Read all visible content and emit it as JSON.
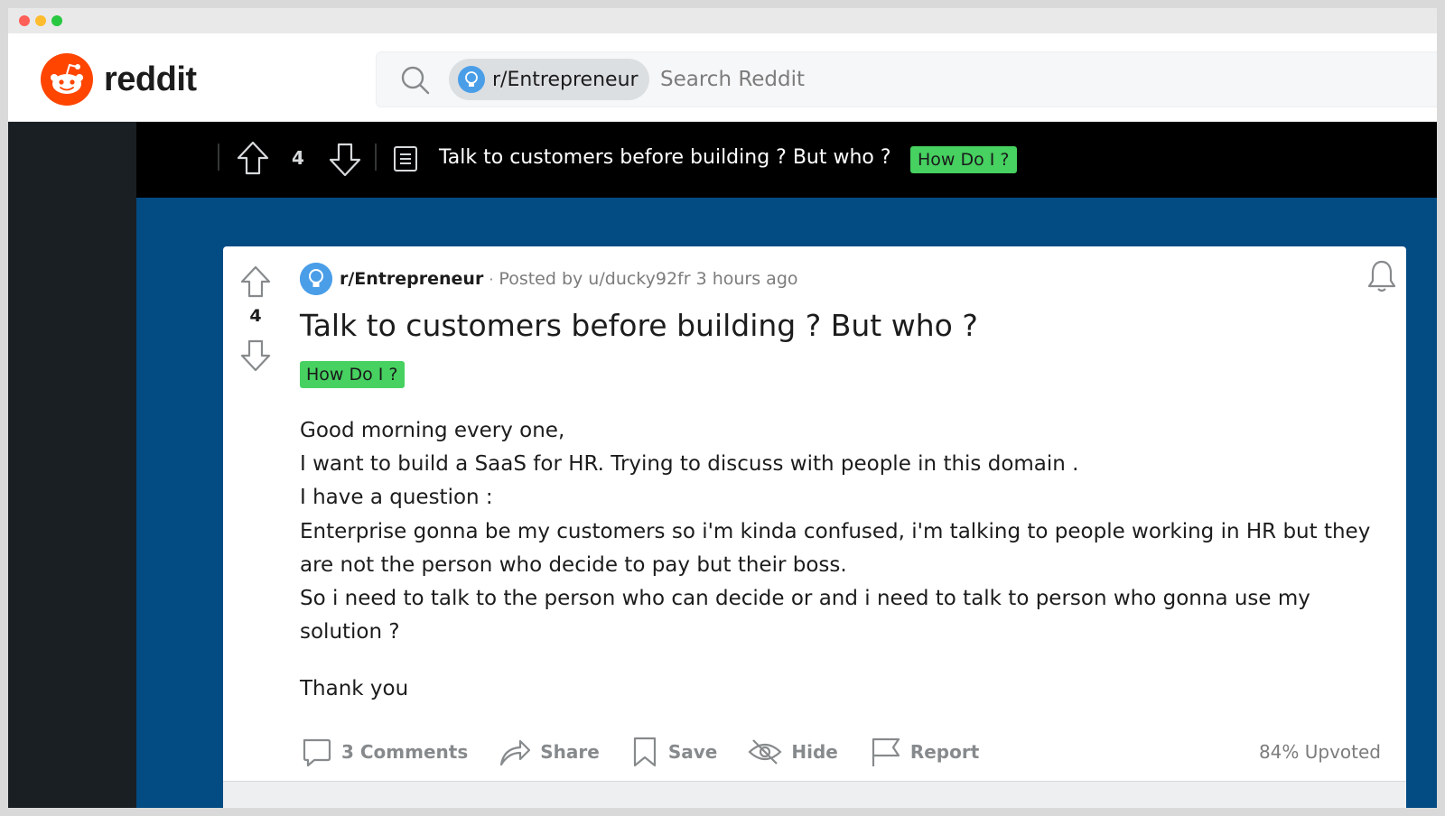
{
  "header": {
    "wordmark": "reddit",
    "search": {
      "community_chip": "r/Entrepreneur",
      "placeholder": "Search Reddit"
    }
  },
  "sticky_bar": {
    "score": "4",
    "title": "Talk to customers before building ? But who ?",
    "flair": "How Do I ?"
  },
  "post": {
    "subreddit": "r/Entrepreneur",
    "separator": "·",
    "posted_by": "Posted by u/ducky92fr 3 hours ago",
    "score": "4",
    "title": "Talk to customers before building ? But who ?",
    "flair": "How Do I ?",
    "body": [
      "Good morning every one,",
      "I want to build a SaaS for HR. Trying to discuss with people in this domain .",
      "I have a question :",
      "Enterprise gonna be my customers so i'm kinda confused, i'm talking to people working in HR but they are not the person who decide to pay but their boss.",
      "So i need to talk to the person who can decide or and i need to talk to person who gonna use my solution ?"
    ],
    "closing": "Thank you",
    "actions": {
      "comments": "3 Comments",
      "share": "Share",
      "save": "Save",
      "hide": "Hide",
      "report": "Report"
    },
    "upvoted": "84% Upvoted"
  },
  "colors": {
    "brand": "#ff4500",
    "flair_bg": "#46d160",
    "banner_blue": "#034b83",
    "sticky_bg": "#000000"
  },
  "icons": [
    "reddit-logo-icon",
    "search-icon",
    "subreddit-icon",
    "upvote-icon",
    "downvote-icon",
    "post-icon",
    "bell-icon",
    "comment-icon",
    "share-icon",
    "save-icon",
    "hide-icon",
    "report-icon"
  ]
}
